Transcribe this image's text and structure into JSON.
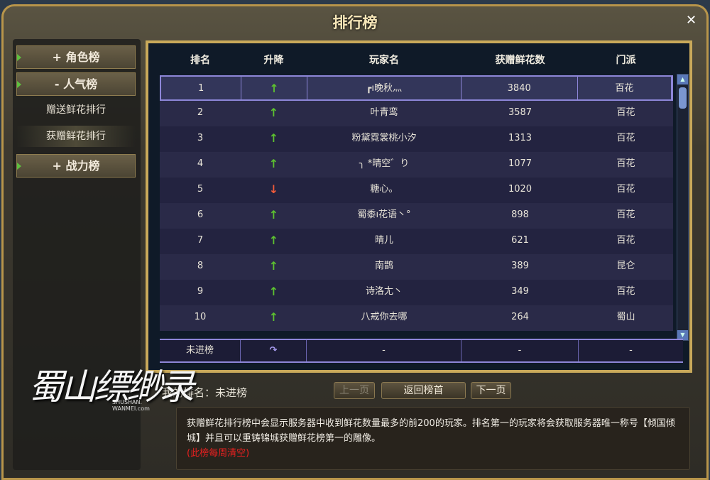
{
  "title": "排行榜",
  "sidebar": {
    "categories": [
      {
        "label": "+ 角色榜"
      },
      {
        "label": "- 人气榜"
      },
      {
        "label": "+ 战力榜"
      }
    ],
    "subitems": [
      {
        "label": "赠送鲜花排行",
        "selected": false
      },
      {
        "label": "获赠鲜花排行",
        "selected": true
      }
    ]
  },
  "table": {
    "headers": [
      "排名",
      "升降",
      "玩家名",
      "获赠鲜花数",
      "门派"
    ],
    "rows": [
      {
        "rank": "1",
        "trend": "up",
        "name": "┏ı晚秋灬",
        "flowers": "3840",
        "sect": "百花"
      },
      {
        "rank": "2",
        "trend": "up",
        "name": "叶青鸾",
        "flowers": "3587",
        "sect": "百花"
      },
      {
        "rank": "3",
        "trend": "up",
        "name": "粉黛霓裳桃小汐",
        "flowers": "1313",
        "sect": "百花"
      },
      {
        "rank": "4",
        "trend": "up",
        "name": "╮ *晴空゛り",
        "flowers": "1077",
        "sect": "百花"
      },
      {
        "rank": "5",
        "trend": "down",
        "name": "糖心。",
        "flowers": "1020",
        "sect": "百花"
      },
      {
        "rank": "6",
        "trend": "up",
        "name": "蜀黍ı花语丶°",
        "flowers": "898",
        "sect": "百花"
      },
      {
        "rank": "7",
        "trend": "up",
        "name": "晴儿",
        "flowers": "621",
        "sect": "百花"
      },
      {
        "rank": "8",
        "trend": "up",
        "name": "南鹊",
        "flowers": "389",
        "sect": "昆仑"
      },
      {
        "rank": "9",
        "trend": "up",
        "name": "诗洛尢丶",
        "flowers": "349",
        "sect": "百花"
      },
      {
        "rank": "10",
        "trend": "up",
        "name": "八戒你去哪",
        "flowers": "264",
        "sect": "蜀山"
      }
    ],
    "my_row": {
      "rank": "未进榜",
      "name": "-",
      "flowers": "-",
      "sect": "-"
    }
  },
  "my_rank": "我的排名：未进榜",
  "pager": {
    "prev": "上一页",
    "home": "返回榜首",
    "next": "下一页"
  },
  "description": {
    "text": "获赠鲜花排行榜中会显示服务器中收到鲜花数量最多的前200的玩家。排名第一的玩家将会获取服务器唯一称号【倾国倾城】并且可以重铸锦城获赠鲜花榜第一的雕像。",
    "note": "(此榜每周清空)"
  },
  "logo": {
    "text": "蜀山缥缈录",
    "sub": "SHUSHAN. WANMEI.com"
  },
  "colors": {
    "up": "#5cc030",
    "down": "#ef5a3a",
    "accent": "#c9a95a"
  }
}
